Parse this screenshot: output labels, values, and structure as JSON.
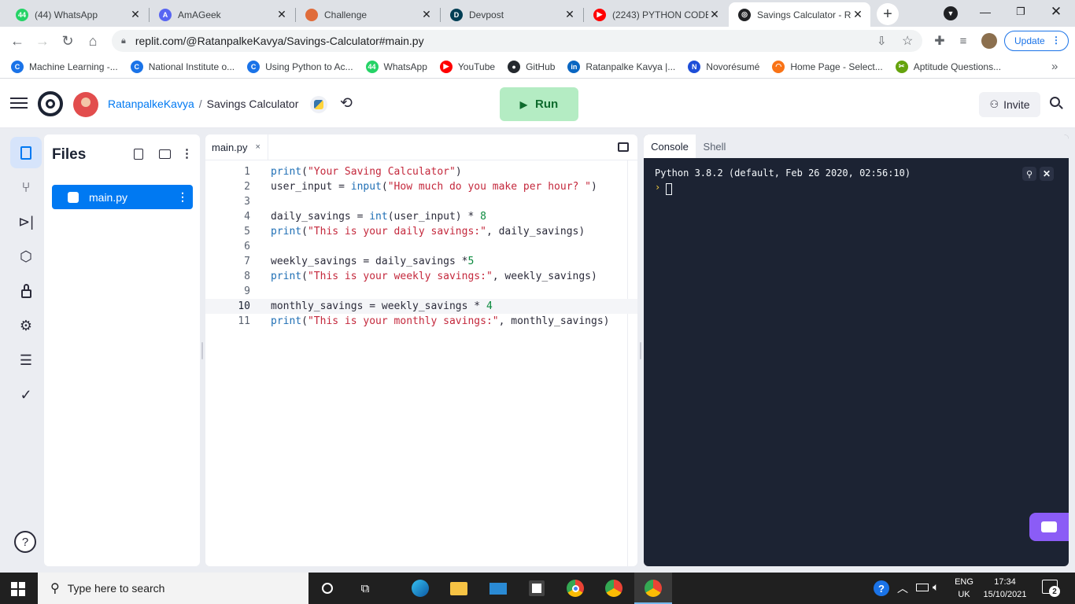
{
  "browser": {
    "tabs": [
      {
        "title": "(44) WhatsApp",
        "favicon_color": "#25d366",
        "favicon_text": "44"
      },
      {
        "title": "AmAGeek",
        "favicon_color": "#5865f2",
        "favicon_text": "A"
      },
      {
        "title": "Challenge",
        "favicon_color": "#e06c3a",
        "favicon_text": ""
      },
      {
        "title": "Devpost",
        "favicon_color": "#003e54",
        "favicon_text": "D"
      },
      {
        "title": "(2243) PYTHON CODE",
        "favicon_color": "#ff0000",
        "favicon_text": "▶"
      },
      {
        "title": "Savings Calculator - Re",
        "favicon_color": "#202124",
        "favicon_text": "◎"
      }
    ],
    "new_tab": "+",
    "url": "replit.com/@RatanpalkeKavya/Savings-Calculator#main.py",
    "update_label": "Update",
    "bookmarks": [
      {
        "label": "Machine Learning -...",
        "icon_color": "#1a73e8",
        "icon": "C"
      },
      {
        "label": "National Institute o...",
        "icon_color": "#1a73e8",
        "icon": "C"
      },
      {
        "label": "Using Python to Ac...",
        "icon_color": "#1a73e8",
        "icon": "C"
      },
      {
        "label": "WhatsApp",
        "icon_color": "#25d366",
        "icon": "44"
      },
      {
        "label": "YouTube",
        "icon_color": "#ff0000",
        "icon": "▶"
      },
      {
        "label": "GitHub",
        "icon_color": "#24292e",
        "icon": "●"
      },
      {
        "label": "Ratanpalke Kavya |...",
        "icon_color": "#0a66c2",
        "icon": "in"
      },
      {
        "label": "Novorésumé",
        "icon_color": "#1d4ed8",
        "icon": "N"
      },
      {
        "label": "Home Page - Select...",
        "icon_color": "#f97316",
        "icon": "◠"
      },
      {
        "label": "Aptitude Questions...",
        "icon_color": "#65a30d",
        "icon": "✂"
      }
    ],
    "bookmarks_more": "»"
  },
  "replit": {
    "user": "RatanpalkeKavya",
    "separator": "/",
    "repl_name": "Savings Calculator",
    "run_label": "Run",
    "invite_label": "Invite",
    "files_title": "Files",
    "files": [
      {
        "name": "main.py",
        "active": true
      }
    ],
    "editor_tab": "main.py",
    "editor_tab_close": "×",
    "console_tabs": [
      "Console",
      "Shell"
    ],
    "console_output": "Python 3.8.2 (default, Feb 26 2020, 02:56:10)",
    "console_prompt": "›",
    "help_label": "?"
  },
  "code": [
    {
      "n": "1",
      "tokens": [
        [
          "kw",
          "print"
        ],
        [
          "op",
          "("
        ],
        [
          "st",
          "\"Your Saving Calculator\""
        ],
        [
          "op",
          ")"
        ]
      ]
    },
    {
      "n": "2",
      "tokens": [
        [
          "op",
          "user_input = "
        ],
        [
          "kw",
          "input"
        ],
        [
          "op",
          "("
        ],
        [
          "st",
          "\"How much do you make per hour? \""
        ],
        [
          "op",
          ")"
        ]
      ]
    },
    {
      "n": "3",
      "tokens": []
    },
    {
      "n": "4",
      "tokens": [
        [
          "op",
          "daily_savings = "
        ],
        [
          "kw",
          "int"
        ],
        [
          "op",
          "(user_input) * "
        ],
        [
          "nm",
          "8"
        ]
      ]
    },
    {
      "n": "5",
      "tokens": [
        [
          "kw",
          "print"
        ],
        [
          "op",
          "("
        ],
        [
          "st",
          "\"This is your daily savings:\""
        ],
        [
          "op",
          ", daily_savings)"
        ]
      ]
    },
    {
      "n": "6",
      "tokens": []
    },
    {
      "n": "7",
      "tokens": [
        [
          "op",
          "weekly_savings = daily_savings *"
        ],
        [
          "nm",
          "5"
        ]
      ]
    },
    {
      "n": "8",
      "tokens": [
        [
          "kw",
          "print"
        ],
        [
          "op",
          "("
        ],
        [
          "st",
          "\"This is your weekly savings:\""
        ],
        [
          "op",
          ", weekly_savings)"
        ]
      ]
    },
    {
      "n": "9",
      "tokens": []
    },
    {
      "n": "10",
      "tokens": [
        [
          "op",
          "monthly_savings = weekly_savings * "
        ],
        [
          "nm",
          "4"
        ]
      ],
      "current": true
    },
    {
      "n": "11",
      "tokens": [
        [
          "kw",
          "print"
        ],
        [
          "op",
          "("
        ],
        [
          "st",
          "\"This is your monthly savings:\""
        ],
        [
          "op",
          ", monthly_savings)"
        ]
      ]
    }
  ],
  "taskbar": {
    "search_placeholder": "Type here to search",
    "lang_top": "ENG",
    "lang_bottom": "UK",
    "time": "17:34",
    "date": "15/10/2021",
    "notif_count": "2"
  }
}
